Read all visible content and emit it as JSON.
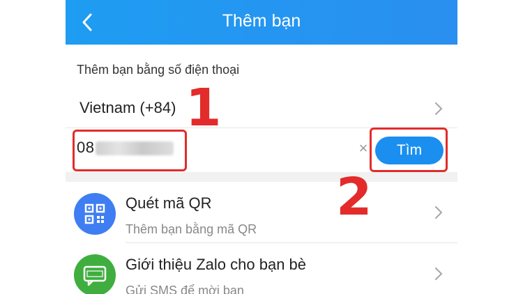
{
  "header": {
    "title": "Thêm bạn"
  },
  "section_label": "Thêm bạn bằng số điện thoại",
  "country": {
    "label": "Vietnam (+84)"
  },
  "phone_input": {
    "value": "08"
  },
  "find_button": {
    "label": "Tìm"
  },
  "items": [
    {
      "title": "Quét mã QR",
      "subtitle": "Thêm bạn bằng mã QR",
      "icon": "qr-code-icon",
      "color": "#3f7df2"
    },
    {
      "title": "Giới thiệu Zalo cho bạn bè",
      "subtitle": "Gửi SMS để mời bạn",
      "icon": "sms-icon",
      "color": "#3fae3f"
    }
  ],
  "annotations": {
    "step1": "1",
    "step2": "2"
  },
  "colors": {
    "header": "#1e9df2",
    "accent": "#1a8ff0",
    "highlight": "#e32b2b"
  }
}
